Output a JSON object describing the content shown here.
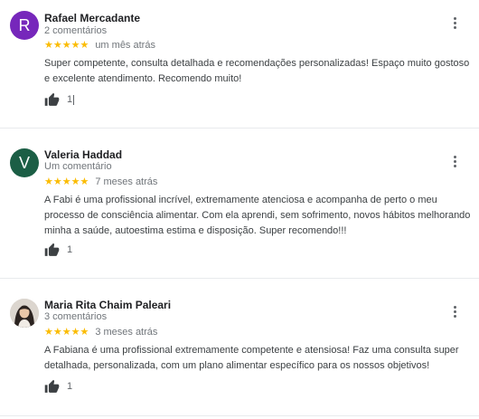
{
  "reviews": [
    {
      "initial": "R",
      "avatar_color": "#7627bb",
      "name": "Rafael Mercadante",
      "comments": "2 comentários",
      "rating": 5,
      "stars": "★★★★★",
      "when": "um mês atrás",
      "text": "Super competente, consulta detalhada e recomendações personalizadas! Espaço muito gostoso e excelente atendimento. Recomendo muito!",
      "likes": "1"
    },
    {
      "initial": "V",
      "avatar_color": "#1b5e45",
      "name": "Valeria Haddad",
      "comments": "Um comentário",
      "rating": 5,
      "stars": "★★★★★",
      "when": "7 meses atrás",
      "text": "A Fabi é  uma profissional incrível, extremamente  atenciosa e acompanha de perto o meu processo de consciência alimentar. Com ela aprendi, sem sofrimento, novos hábitos melhorando minha a saúde, autoestima estima e disposição. Super recomendo!!!",
      "likes": "1"
    },
    {
      "initial": "",
      "avatar_color": "#d9d4cf",
      "name": "Maria Rita Chaim Paleari",
      "comments": "3 comentários",
      "rating": 5,
      "stars": "★★★★★",
      "when": "3 meses atrás",
      "text": "A Fabiana é uma profissional extremamente competente e atensiosa! Faz uma consulta super detalhada,  personalizada, com um plano alimentar específico para os nossos objetivos!",
      "likes": "1"
    }
  ]
}
